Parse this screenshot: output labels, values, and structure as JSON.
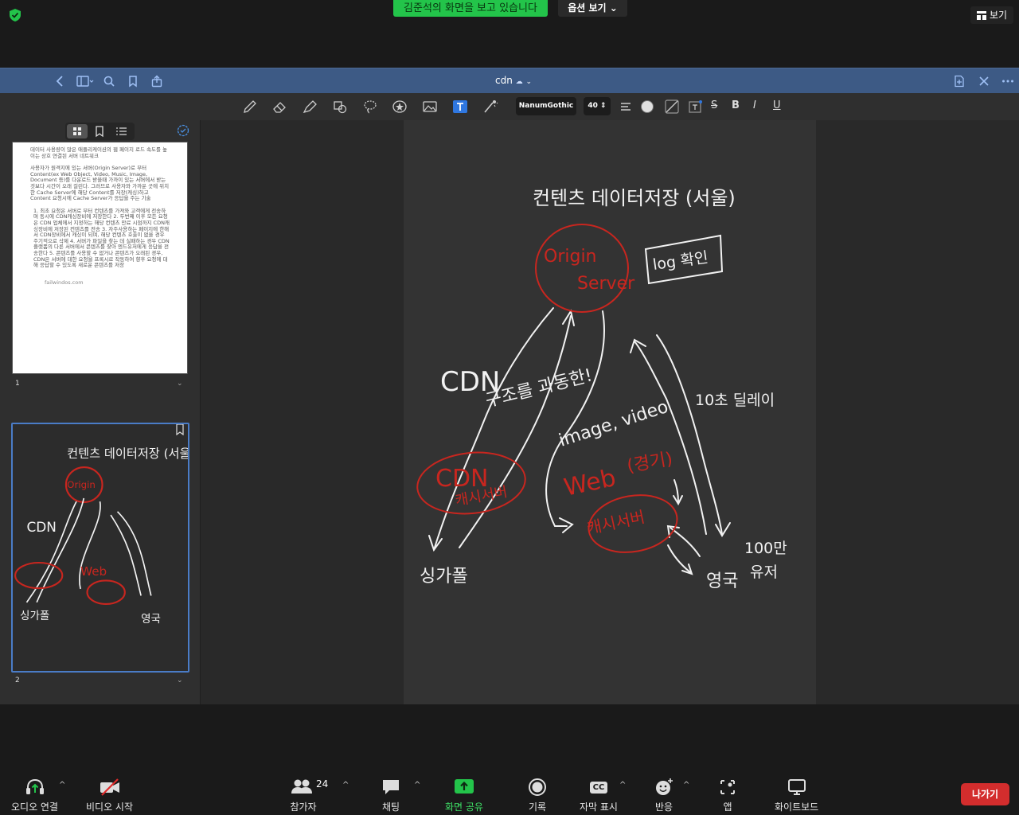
{
  "zoom": {
    "share_banner": "김준석의 화면을 보고 있습니다",
    "options_label": "옵션 보기",
    "view_label": "보기",
    "participants_count": "24",
    "bottom": {
      "audio": "오디오 연결",
      "video": "비디오 시작",
      "participants": "참가자",
      "chat": "채팅",
      "share": "화면 공유",
      "record": "기록",
      "captions": "자막 표시",
      "cc": "CC",
      "reactions": "반응",
      "apps": "앱",
      "whiteboard": "화이트보드",
      "leave": "나가기"
    },
    "colors": {
      "share_green": "#23c44a",
      "leave_red": "#d32d2d"
    }
  },
  "app": {
    "doc_title": "cdn",
    "header_color": "#3d5a85",
    "font_name": "NanumGothic",
    "font_size": "40",
    "format": {
      "bold": "B",
      "italic": "I",
      "underline": "U",
      "strike": "S"
    }
  },
  "sidebar": {
    "page1_number": "1",
    "page2_number": "2",
    "page1_text": [
      "데이터 사용량이 많은 애플리케이션의 웹 페이지 로드 속도를 높이는 상호 연결된 서버 네트워크",
      "사용자가 원격지에 있는 서버(Origin Server)로 부터 Content(ex Web Object, Video, Music, Image, Document 등)를 다운로드 받을때 가까이 있는 서버에서 받는 것보다 시간이 오래 걸린다. 그러므로 사용자와 가까운 곳에 위치한 Cache Server에 해당 Content를 저장(캐싱)하고 Content 요청시에 Cache Server가 응답을 주는 기술",
      "1. 최초 요청은 서버로 부터 컨텐츠를 가져와 고객에게 전송하며 동시에 CDN캐싱장비에 저장한다 2. 두번째 이후 모든 요청은 CDN 업체에서 지정하는 해당 컨텐츠 만료 시점까지 CDN캐싱장비에 저장된 컨텐츠를 전송 3. 자주사용하는 페이지에 한해서 CDN장비에서 캐싱이 되며, 해당 컨텐츠 호출이 없을 경우 주기적으로 삭제 4. 서버가 파일을 찾는 데 실패하는 경우 CDN 플랫폼의 다른 서버에서 콘텐츠를 찾아 엔드유저에게 응답을 전송한다 5. 콘텐츠를 사용할 수 없거나 콘텐츠가 오래된 경우, CDN은 서버에 대한 요청을 프록시로 작동하여 향후 요청에 대해 응답할 수 있도록 새로운 콘텐츠를 저장",
      "failwindos.com"
    ]
  },
  "whiteboard": {
    "title": "컨텐츠 데이터저장 (서울)",
    "origin_line1": "Origin",
    "origin_line2": "Server",
    "log_label": "log 확인",
    "cdn_label": "CDN",
    "structure_label": "구조를 과동한!",
    "delay_label": "10초 딜레이",
    "image_video": "image, video",
    "cdn_cache_line1": "CDN",
    "cdn_cache_line2": "캐시서버",
    "web_label": "Web",
    "web_region": "(경기)",
    "cache_server": "캐시서버",
    "singapore": "싱가폴",
    "uk": "영국",
    "users_count": "100만",
    "users": "유저",
    "ink_white": "#f2f2f2",
    "ink_red": "#c8261f"
  }
}
